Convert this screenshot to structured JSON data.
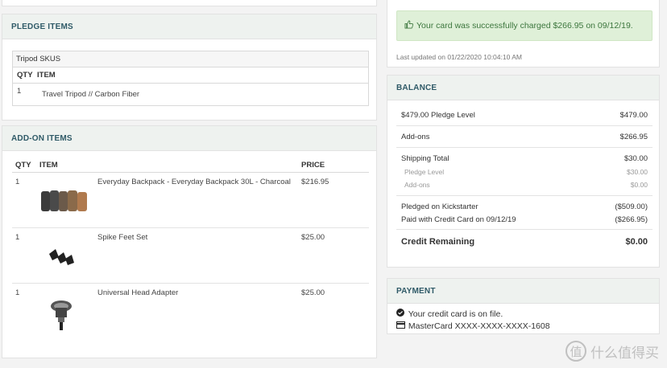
{
  "pledge": {
    "header": "PLEDGE ITEMS",
    "sku_title": "Tripod SKUS",
    "columns": {
      "qty": "QTY",
      "item": "ITEM"
    },
    "rows": [
      {
        "qty": "1",
        "item": "Travel Tripod // Carbon Fiber"
      }
    ]
  },
  "addons": {
    "header": "ADD-ON ITEMS",
    "columns": {
      "qty": "QTY",
      "item": "ITEM",
      "price": "PRICE"
    },
    "rows": [
      {
        "qty": "1",
        "name": "Everyday Backpack - Everyday Backpack 30L - Charcoal",
        "price": "$216.95",
        "icon": "backpack-icon"
      },
      {
        "qty": "1",
        "name": "Spike Feet Set",
        "price": "$25.00",
        "icon": "spike-feet-icon"
      },
      {
        "qty": "1",
        "name": "Universal Head Adapter",
        "price": "$25.00",
        "icon": "head-adapter-icon"
      }
    ]
  },
  "status": {
    "message": "Your card was successfully charged $266.95 on 09/12/19.",
    "last_updated": "Last updated on 01/22/2020 10:04:10 AM",
    "color": "#dff0d8"
  },
  "balance": {
    "header": "BALANCE",
    "pledge_level_label": "$479.00 Pledge Level",
    "pledge_level_value": "$479.00",
    "addons_label": "Add-ons",
    "addons_value": "$266.95",
    "shipping_label": "Shipping Total",
    "shipping_value": "$30.00",
    "ship_pledge_label": "Pledge Level",
    "ship_pledge_value": "$30.00",
    "ship_addons_label": "Add-ons",
    "ship_addons_value": "$0.00",
    "pledged_label": "Pledged on Kickstarter",
    "pledged_value": "($509.00)",
    "paid_label": "Paid with Credit Card on 09/12/19",
    "paid_value": "($266.95)",
    "credit_label": "Credit Remaining",
    "credit_value": "$0.00"
  },
  "payment": {
    "header": "PAYMENT",
    "on_file": "Your credit card is on file.",
    "card": "MasterCard XXXX-XXXX-XXXX-1608"
  },
  "watermark": {
    "text": "什么值得买",
    "logo": "值"
  },
  "colors": {
    "header_bg": "#eef2ef",
    "header_text": "#2f5a67",
    "success_text": "#3c763d"
  }
}
